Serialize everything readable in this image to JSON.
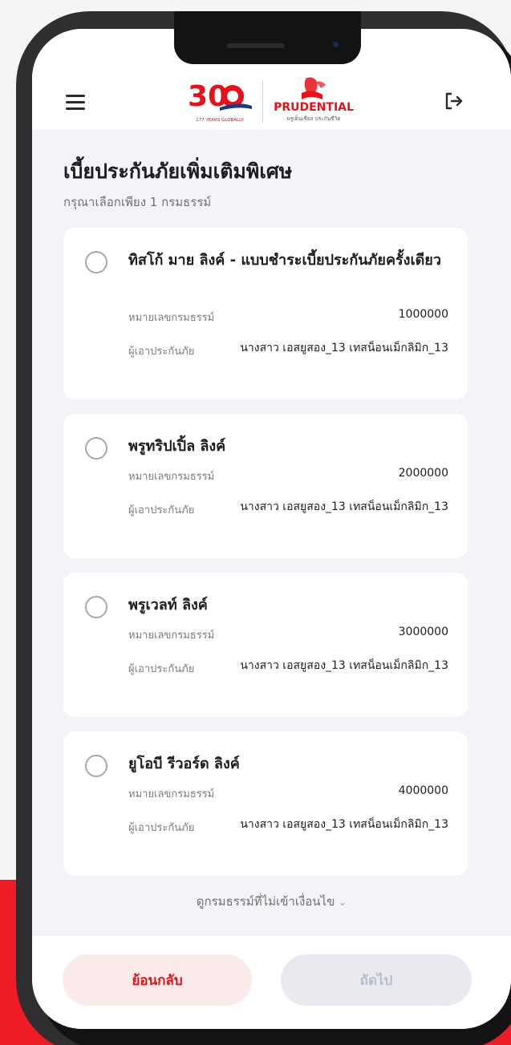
{
  "header": {
    "logo_30_text": "30",
    "logo_30_sub": "177 YEARS GLOBALLY",
    "logo_pru_name": "PRUDENTIAL",
    "logo_pru_tagline": "พรูเด็นเชียล ประกันชีวิต"
  },
  "page": {
    "title": "เบี้ยประกันภัยเพิ่มเติมพิเศษ",
    "subtitle": "กรุณาเลือกเพียง 1 กรมธรรม์"
  },
  "labels": {
    "policy_number": "หมายเลขกรมธรรม์",
    "insured": "ผู้เอาประกันภัย"
  },
  "policies": [
    {
      "name": "ทิสโก้ มาย ลิงค์ - แบบชำระเบี้ยประกันภัยครั้งเดียว",
      "policy_number": "1000000",
      "insured": "นางสาว เอสยูสอง_13 เทสน็อนเม็กลิมิก_13",
      "selected": false
    },
    {
      "name": "พรูทริปเปิ้ล ลิงค์",
      "policy_number": "2000000",
      "insured": "นางสาว เอสยูสอง_13 เทสน็อนเม็กลิมิก_13",
      "selected": false
    },
    {
      "name": "พรูเวลท์ ลิงค์",
      "policy_number": "3000000",
      "insured": "นางสาว เอสยูสอง_13 เทสน็อนเม็กลิมิก_13",
      "selected": false
    },
    {
      "name": "ยูโอบี รีวอร์ด ลิงค์",
      "policy_number": "4000000",
      "insured": "นางสาว เอสยูสอง_13 เทสน็อนเม็กลิมิก_13",
      "selected": false
    }
  ],
  "view_ineligible": "ดูกรมธรรม์ที่ไม่เข้าเงื่อนไข",
  "footer": {
    "back_label": "ย้อนกลับ",
    "next_label": "ถัดไป",
    "next_enabled": false
  },
  "colors": {
    "brand_red": "#e4121b",
    "background_band": "#ee1c25",
    "screen_bg": "#f3f4f7"
  },
  "icons": {
    "menu": "hamburger-menu-icon",
    "logout": "logout-icon",
    "radio": "radio-unchecked-icon",
    "chevron": "chevron-down-icon"
  }
}
